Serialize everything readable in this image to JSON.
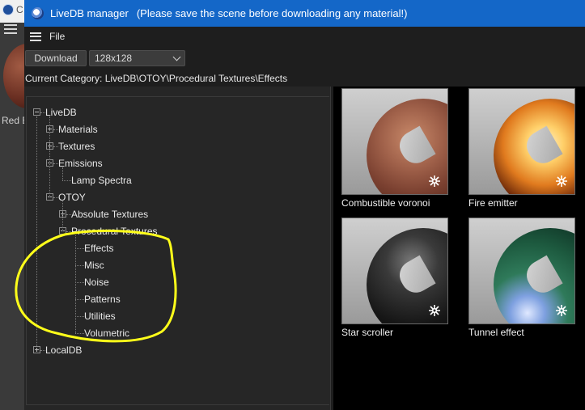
{
  "background_app": {
    "title_letter": "C",
    "thumb_label": "Red B"
  },
  "window": {
    "title": "LiveDB manager",
    "subtitle": "(Please save the scene before downloading any material!)"
  },
  "menu": {
    "file_label": "File"
  },
  "toolbar": {
    "download_label": "Download",
    "size_selected": "128x128"
  },
  "category": {
    "text": "Current Category: LiveDB\\OTOY\\Procedural Textures\\Effects"
  },
  "tree": {
    "nodes": [
      {
        "label": "LiveDB",
        "level": 0,
        "expander": "minus"
      },
      {
        "label": "Materials",
        "level": 1,
        "expander": "plus"
      },
      {
        "label": "Textures",
        "level": 1,
        "expander": "plus"
      },
      {
        "label": "Emissions",
        "level": 1,
        "expander": "minus"
      },
      {
        "label": "Lamp Spectra",
        "level": 2,
        "expander": "none"
      },
      {
        "label": "OTOY",
        "level": 1,
        "expander": "minus"
      },
      {
        "label": "Absolute Textures",
        "level": 2,
        "expander": "plus"
      },
      {
        "label": "Procedural Textures",
        "level": 2,
        "expander": "minus"
      },
      {
        "label": "Effects",
        "level": 3,
        "expander": "none"
      },
      {
        "label": "Misc",
        "level": 3,
        "expander": "none"
      },
      {
        "label": "Noise",
        "level": 3,
        "expander": "none"
      },
      {
        "label": "Patterns",
        "level": 3,
        "expander": "none"
      },
      {
        "label": "Utilities",
        "level": 3,
        "expander": "none"
      },
      {
        "label": "Volumetric",
        "level": 3,
        "expander": "none"
      },
      {
        "label": "LocalDB",
        "level": 0,
        "expander": "plus"
      }
    ]
  },
  "materials": [
    {
      "label": "Combustible voronoi",
      "style": "voronoi"
    },
    {
      "label": "Fire emitter",
      "style": "fire"
    },
    {
      "label": "Star scroller",
      "style": "star"
    },
    {
      "label": "Tunnel effect",
      "style": "tunnel"
    }
  ],
  "colors": {
    "titlebar": "#1467c8",
    "highlight_annotation": "#ffff1a"
  }
}
